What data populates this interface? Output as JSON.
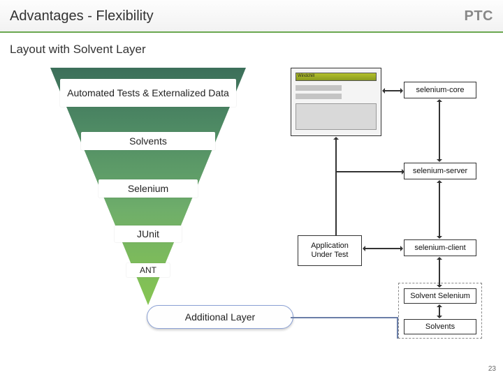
{
  "header": {
    "title": "Advantages - Flexibility",
    "logo": "PTC"
  },
  "subtitle": "Layout with Solvent Layer",
  "triangle": {
    "bands": [
      "Automated Tests & Externalized Data",
      "Solvents",
      "Selenium",
      "JUnit",
      "ANT"
    ]
  },
  "callout": {
    "label": "Additional Layer"
  },
  "diagram": {
    "browser_label": "Windchill",
    "boxes": {
      "selenium_core": "selenium-core",
      "selenium_server": "selenium-server",
      "selenium_client": "selenium-client",
      "aut": "Application Under Test",
      "solvent_selenium": "Solvent Selenium",
      "solvents": "Solvents"
    }
  },
  "page_number": "23"
}
